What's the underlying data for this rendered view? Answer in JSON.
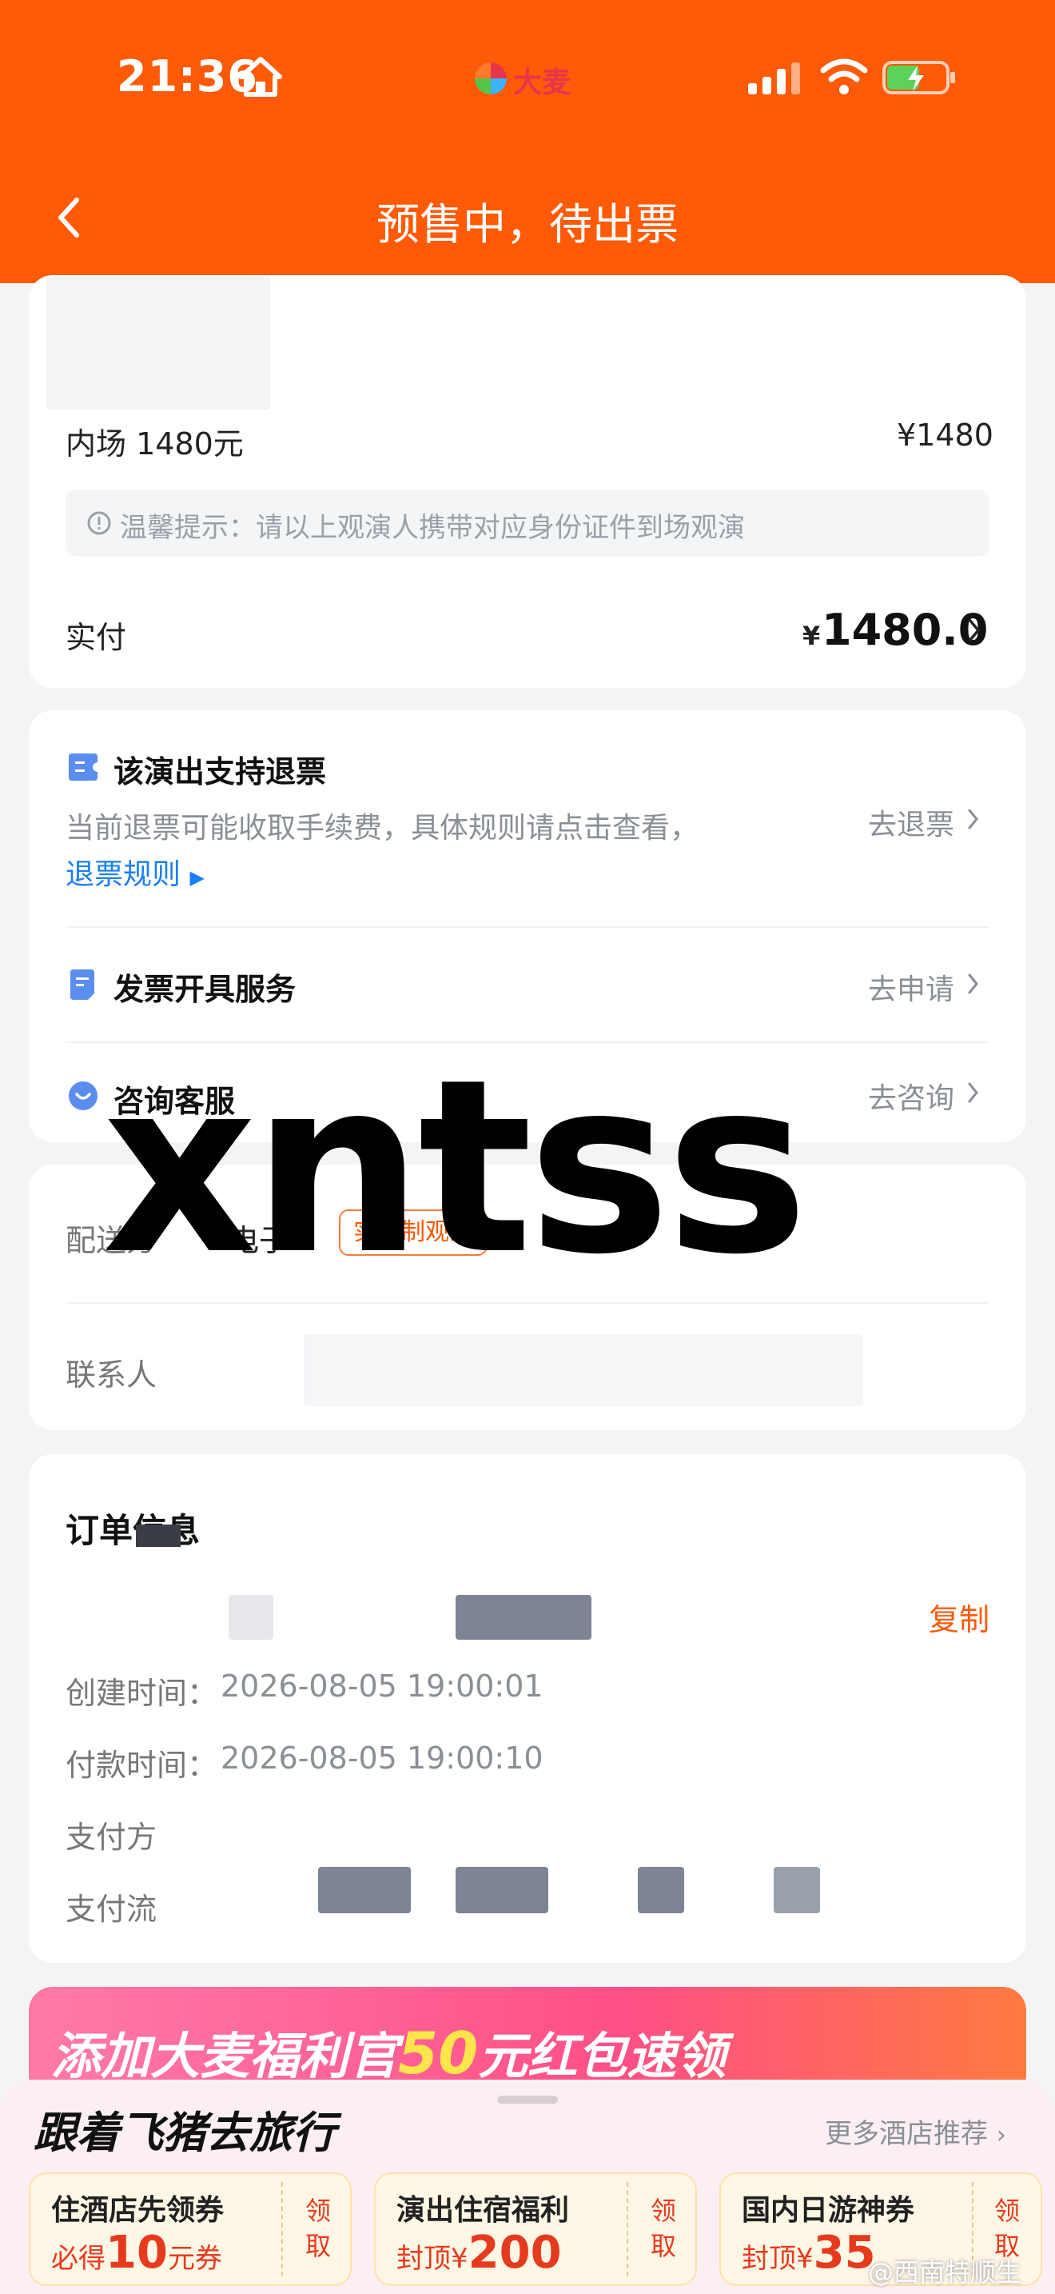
{
  "status_bar": {
    "time": "21:36",
    "brand": "大麦"
  },
  "nav": {
    "title": "预售中，待出票"
  },
  "ticket_card": {
    "ticket_name": "内场 1480元",
    "ticket_price": "¥1480",
    "tip": "温馨提示：请以上观演人携带对应身份证件到场观演",
    "paid_label": "实付",
    "paid_currency": "¥",
    "paid_amount": "1480.0"
  },
  "services_card": {
    "refund_title": "该演出支持退票",
    "refund_desc": "当前退票可能收取手续费，具体规则请点击查看，",
    "refund_rules_link": "退票规则",
    "refund_action": "去退票",
    "invoice_title": "发票开具服务",
    "invoice_action": "去申请",
    "support_title": "咨询客服",
    "support_action": "去咨询"
  },
  "delivery_card": {
    "delivery_label": "配送方",
    "delivery_value": "电子",
    "delivery_badge": "实名制观演",
    "contact_label": "联系人"
  },
  "order_card": {
    "title": "订单信息",
    "copy_action": "复制",
    "created_label": "创建时间：",
    "created_value": "2026-08-05 19:00:01",
    "paid_time_label": "付款时间：",
    "paid_time_value": "2026-08-05 19:00:10",
    "pay_method_label": "支付方",
    "pay_channel_label": "支付流"
  },
  "watermark": "xntss",
  "banner": {
    "text_a": "添加大麦福利官",
    "text_b": "50",
    "text_c": "元红包速领"
  },
  "bottom_sheet": {
    "title": "跟着飞猪去旅行",
    "more": "更多酒店推荐",
    "coupons": [
      {
        "title": "住酒店先领券",
        "prefix": "必得",
        "amount": "10",
        "suffix": "元券",
        "action": "领取"
      },
      {
        "title": "演出住宿福利",
        "prefix": "封顶¥",
        "amount": "200",
        "suffix": "",
        "action": "领取"
      },
      {
        "title": "国内日游神券",
        "prefix": "封顶¥",
        "amount": "35",
        "suffix": "",
        "action": "领取"
      }
    ],
    "credit": "@西南特顺生"
  },
  "colors": {
    "accent": "#ff5a07",
    "link": "#1a7ef5",
    "price_red": "#e63a1e"
  }
}
